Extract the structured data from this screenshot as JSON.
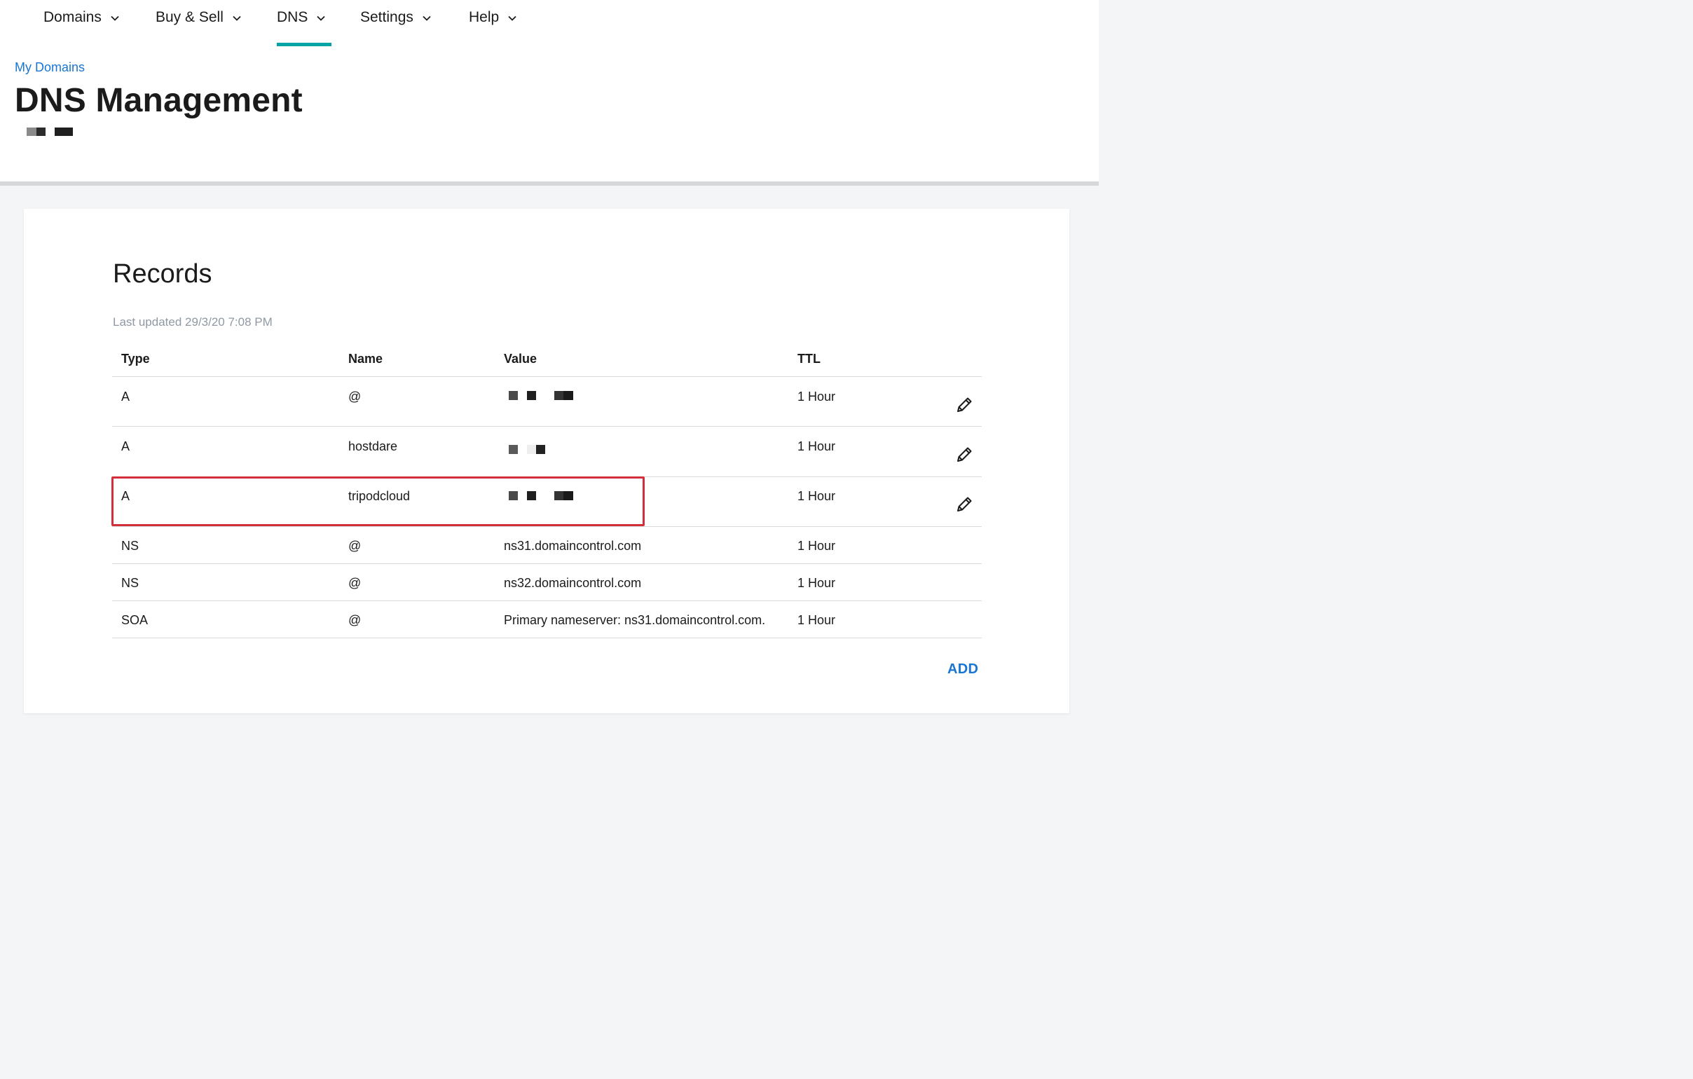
{
  "nav": {
    "items": [
      {
        "label": "Domains"
      },
      {
        "label": "Buy & Sell"
      },
      {
        "label": "DNS"
      },
      {
        "label": "Settings"
      },
      {
        "label": "Help"
      }
    ],
    "active": "DNS",
    "accent_color": "#00a4a6"
  },
  "breadcrumb": {
    "label": "My Domains"
  },
  "page": {
    "title": "DNS Management"
  },
  "records": {
    "title": "Records",
    "last_updated": "Last updated 29/3/20 7:08 PM",
    "columns": {
      "type": "Type",
      "name": "Name",
      "value": "Value",
      "ttl": "TTL"
    },
    "rows": [
      {
        "type": "A",
        "name": "@",
        "value": "",
        "ttl": "1 Hour",
        "editable": true
      },
      {
        "type": "A",
        "name": "hostdare",
        "value": "",
        "ttl": "1 Hour",
        "editable": true
      },
      {
        "type": "A",
        "name": "tripodcloud",
        "value": "",
        "ttl": "1 Hour",
        "editable": true,
        "highlighted": true
      },
      {
        "type": "NS",
        "name": "@",
        "value": "ns31.domaincontrol.com",
        "ttl": "1 Hour",
        "editable": false
      },
      {
        "type": "NS",
        "name": "@",
        "value": "ns32.domaincontrol.com",
        "ttl": "1 Hour",
        "editable": false
      },
      {
        "type": "SOA",
        "name": "@",
        "value": "Primary nameserver: ns31.domaincontrol.com.",
        "ttl": "1 Hour",
        "editable": false
      }
    ],
    "add_label": "ADD"
  },
  "colors": {
    "link": "#1976d2",
    "highlight_border": "#d32f3a",
    "muted_text": "#8f99a3"
  }
}
